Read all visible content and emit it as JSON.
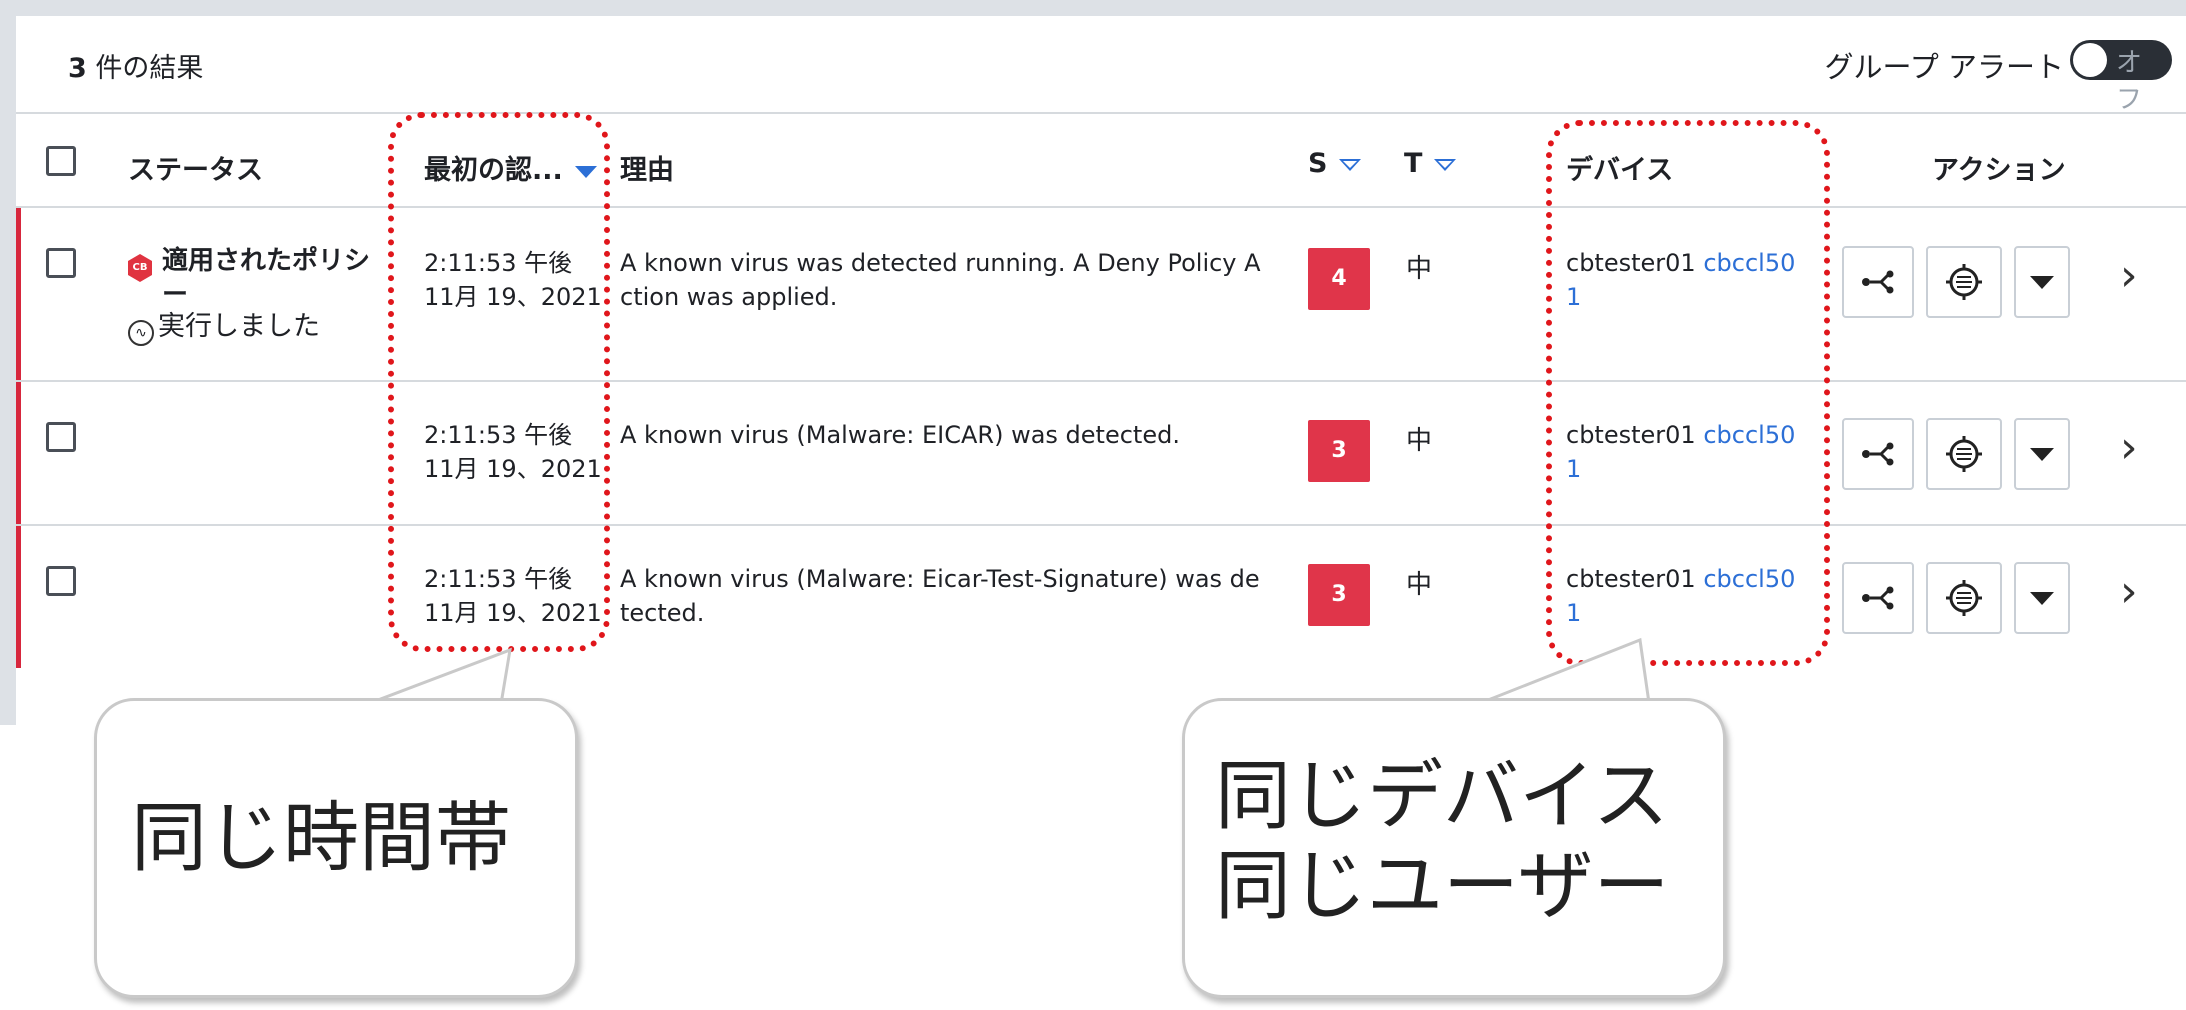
{
  "header": {
    "result_count_num": "3",
    "result_count_label": " 件の結果",
    "group_alert_label": "グループ アラート",
    "toggle_state": "オフ"
  },
  "columns": {
    "status": "ステータス",
    "first_seen": "最初の認...",
    "reason": "理由",
    "severity": "S",
    "type": "T",
    "device": "デバイス",
    "actions": "アクション"
  },
  "rows": [
    {
      "status_name_line1": "適用されたポリシ",
      "status_name_line2": "ー",
      "status_badge": "CB",
      "status_sub": "実行しました",
      "time": "2:11:53 午後",
      "date": "11月 19、2021",
      "reason_line1": "A known virus was detected running. A Deny Policy A",
      "reason_line2": "ction was applied.",
      "severity": "4",
      "type": "中",
      "device_name": "cbtester01",
      "device_user_line1": "cbccl50",
      "device_user_line2": "1"
    },
    {
      "time": "2:11:53 午後",
      "date": "11月 19、2021",
      "reason_line1": "A known virus (Malware: EICAR) was detected.",
      "reason_line2": "",
      "severity": "3",
      "type": "中",
      "device_name": "cbtester01",
      "device_user_line1": "cbccl50",
      "device_user_line2": "1"
    },
    {
      "time": "2:11:53 午後",
      "date": "11月 19、2021",
      "reason_line1": "A known virus (Malware: Eicar-Test-Signature) was de",
      "reason_line2": "tected.",
      "severity": "3",
      "type": "中",
      "device_name": "cbtester01",
      "device_user_line1": "cbccl50",
      "device_user_line2": "1"
    }
  ],
  "icons": {
    "process_tree": "process-tree-icon",
    "investigate": "target-icon",
    "more": "caret-down-icon",
    "details": "chevron-right-icon"
  },
  "callouts": {
    "left_text": "同じ時間帯",
    "right_line1": "同じデバイス",
    "right_line2": "同じユーザー"
  },
  "colors": {
    "accent_red": "#d7263d",
    "severity_red": "#e0354a",
    "link_blue": "#2c6fd6",
    "annotation_red": "#e0161b"
  }
}
